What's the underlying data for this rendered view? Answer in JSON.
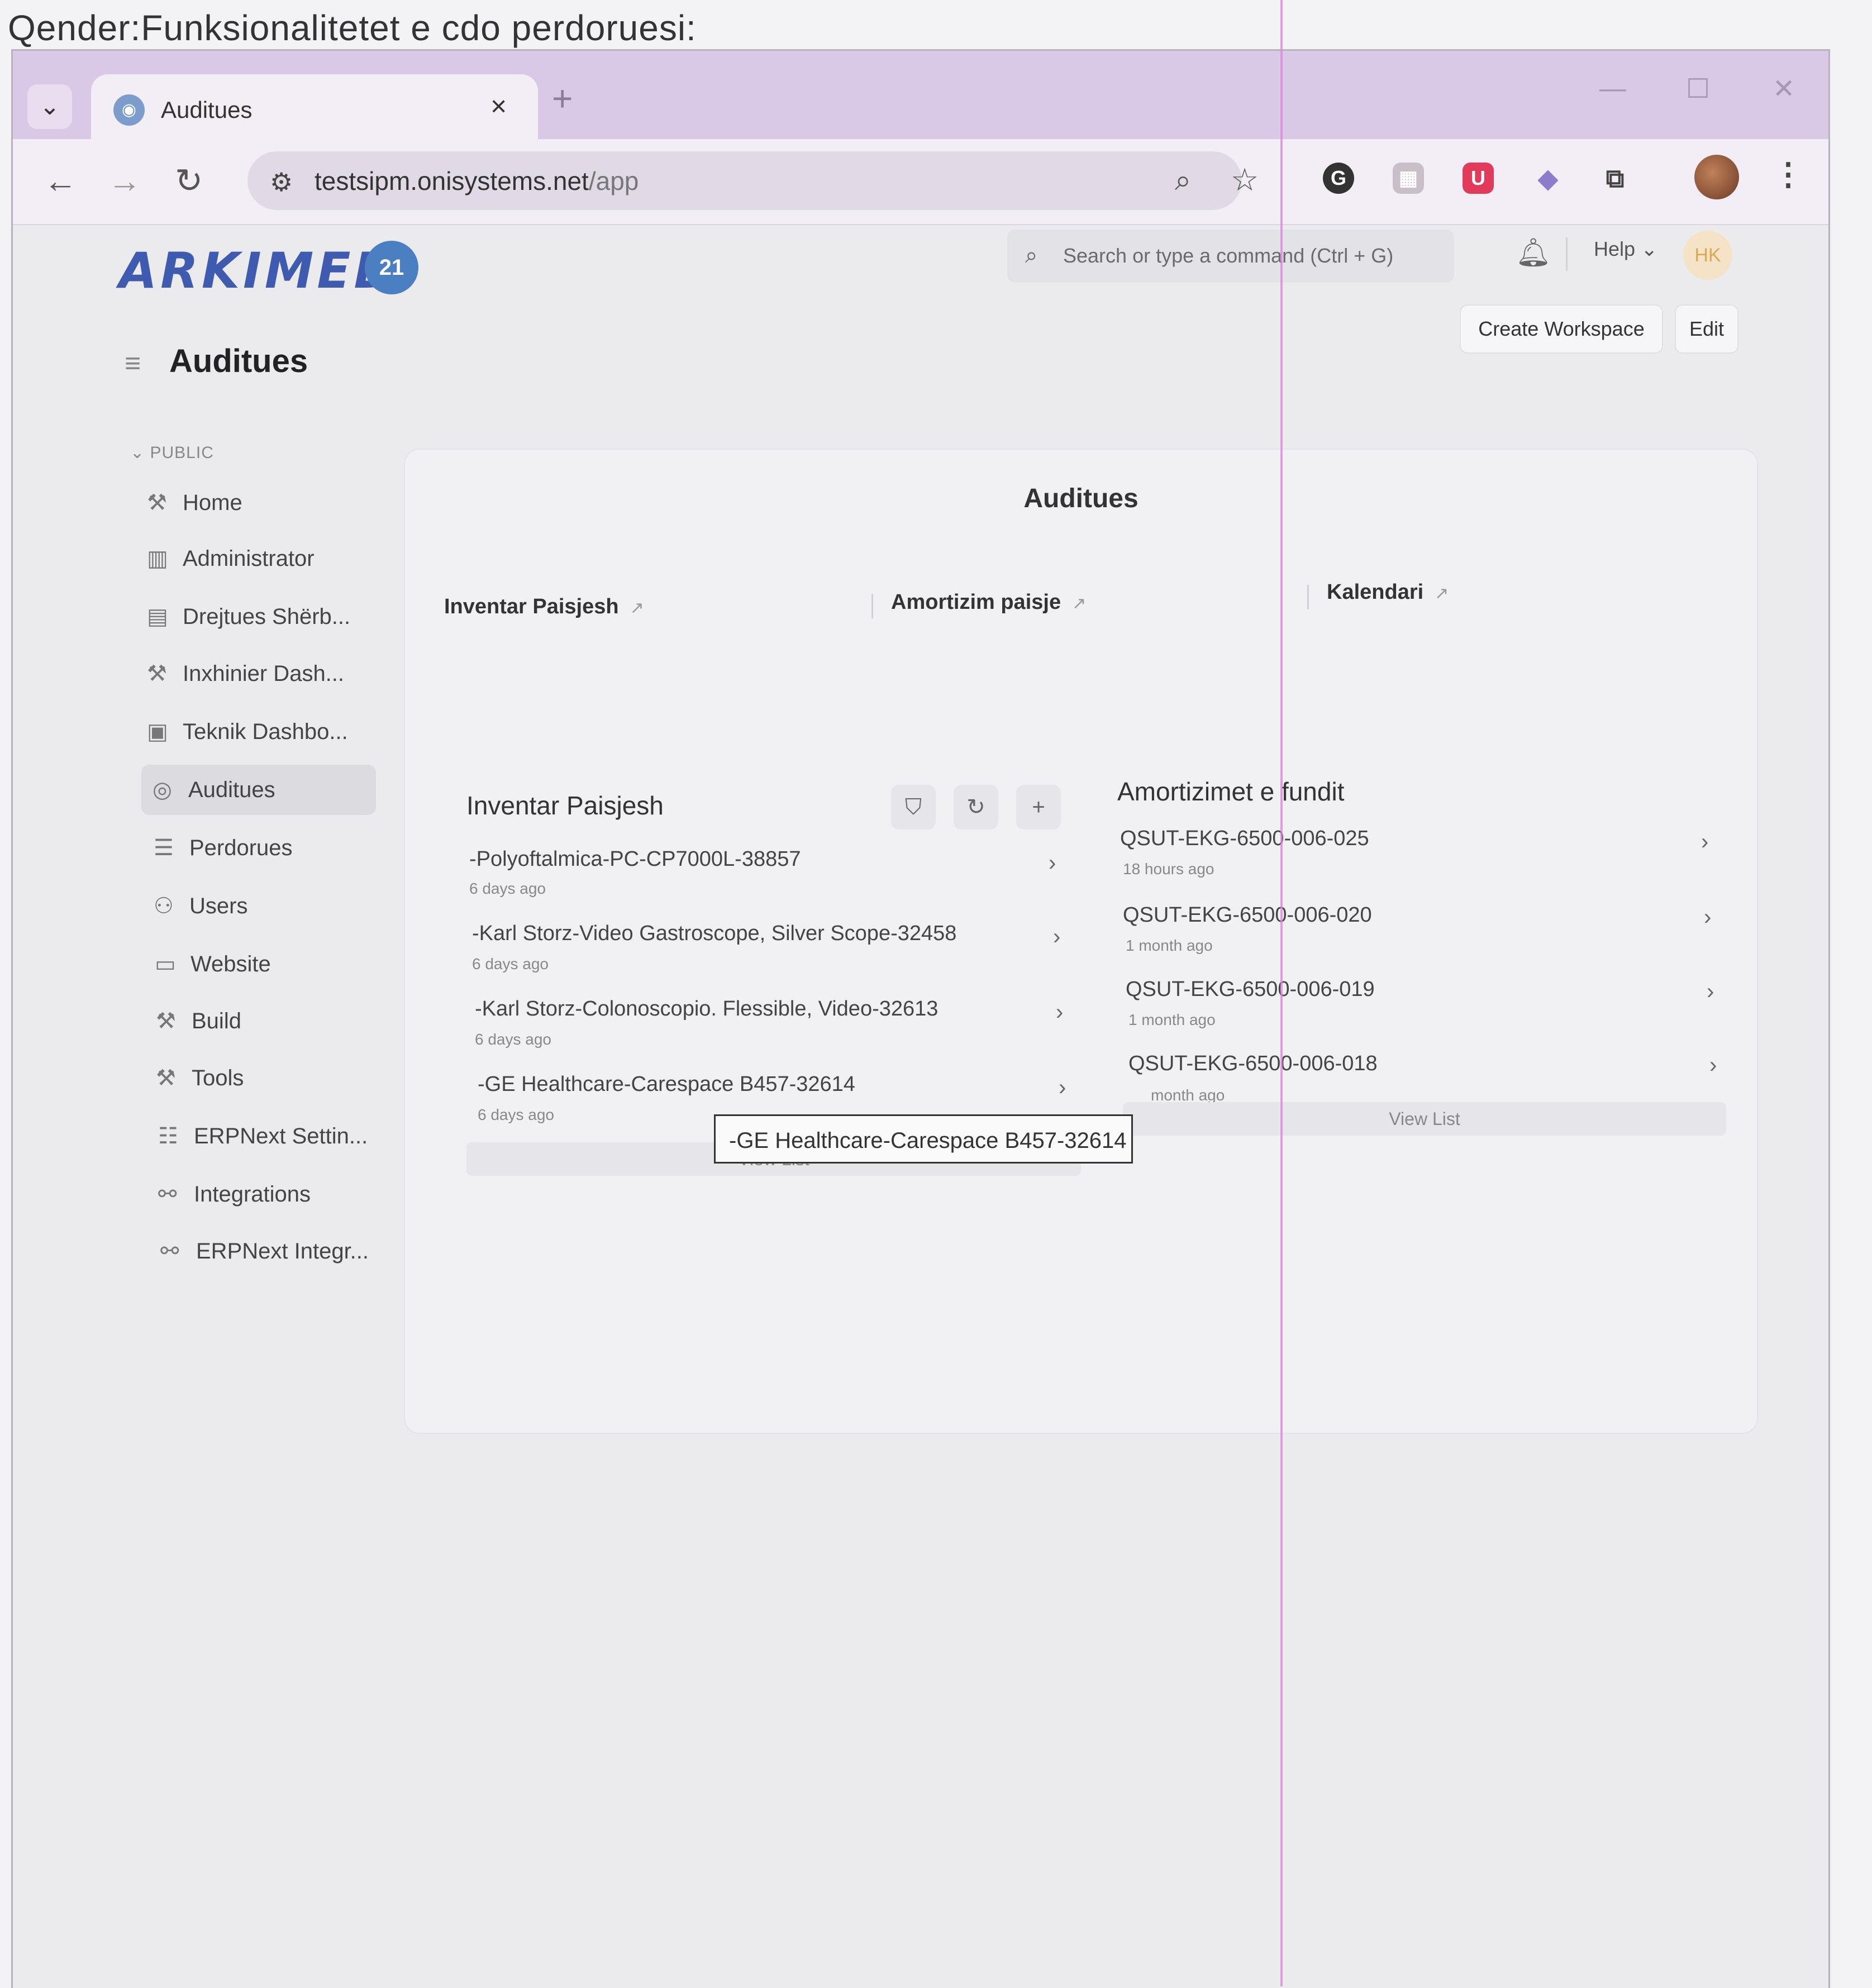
{
  "caption": "Qender:Funksionalitetet e cdo perdoruesi:",
  "browser": {
    "tab_title": "Auditues",
    "tab_close": "×",
    "new_tab": "+",
    "url_host": "testsipm.onisystems.net",
    "url_path": "/app",
    "icons": [
      "chevron-down",
      "back",
      "forward",
      "reload",
      "tune",
      "zoom",
      "star",
      "grammarly",
      "ext",
      "shield",
      "ext-bird",
      "puzzle",
      "profile",
      "kebab"
    ]
  },
  "app": {
    "logo_text": "ARKIMED",
    "logo_badge": "21",
    "search_placeholder": "Search or type a command (Ctrl + G)",
    "help_label": "Help",
    "avatar_initials": "HK",
    "create_workspace": "Create Workspace",
    "edit": "Edit",
    "page_title": "Auditues"
  },
  "sidebar": {
    "section": "PUBLIC",
    "items": [
      {
        "label": "Home",
        "icon": "tools-icon"
      },
      {
        "label": "Administrator",
        "icon": "building-icon"
      },
      {
        "label": "Drejtues Shërb...",
        "icon": "calendar-icon"
      },
      {
        "label": "Inxhinier Dash...",
        "icon": "tools-icon"
      },
      {
        "label": "Teknik Dashbo...",
        "icon": "form-icon"
      },
      {
        "label": "Auditues",
        "icon": "circle-icon"
      },
      {
        "label": "Perdorues",
        "icon": "list-icon"
      },
      {
        "label": "Users",
        "icon": "users-icon"
      },
      {
        "label": "Website",
        "icon": "browser-icon"
      },
      {
        "label": "Build",
        "icon": "tools-icon"
      },
      {
        "label": "Tools",
        "icon": "tools-icon"
      },
      {
        "label": "ERPNext Settin...",
        "icon": "database-icon"
      },
      {
        "label": "Integrations",
        "icon": "link-icon"
      },
      {
        "label": "ERPNext Integr...",
        "icon": "link-icon"
      }
    ]
  },
  "main": {
    "title": "Auditues",
    "shortcuts": [
      "Inventar Paisjesh",
      "Amortizim paisje",
      "Kalendari"
    ],
    "inventory": {
      "title": "Inventar Paisjesh",
      "rows": [
        {
          "title": "-Polyoftalmica-PC-CP7000L-38857",
          "sub": "6 days ago"
        },
        {
          "title": "-Karl Storz-Video Gastroscope, Silver Scope-32458",
          "sub": "6 days ago"
        },
        {
          "title": "-Karl Storz-Colonoscopio. Flessible, Video-32613",
          "sub": "6 days ago"
        },
        {
          "title": "-GE Healthcare-Carespace B457-32614",
          "sub": "6 days ago"
        }
      ],
      "view_list": "View List",
      "tooltip": "-GE Healthcare-Carespace B457-32614"
    },
    "depreciation": {
      "title": "Amortizimet e fundit",
      "rows": [
        {
          "title": "QSUT-EKG-6500-006-025",
          "sub": "18 hours ago"
        },
        {
          "title": "QSUT-EKG-6500-006-020",
          "sub": "1 month ago"
        },
        {
          "title": "QSUT-EKG-6500-006-019",
          "sub": "1 month ago"
        },
        {
          "title": "QSUT-EKG-6500-006-018",
          "sub": "month ago"
        }
      ],
      "view_list": "View List"
    }
  }
}
